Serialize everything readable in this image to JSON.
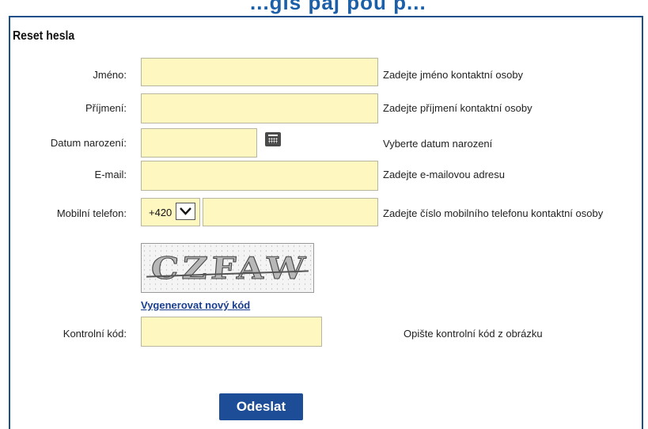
{
  "header": {
    "partial_title": "...gis paj  pou p..."
  },
  "panel": {
    "title": "Reset hesla"
  },
  "form": {
    "first_name": {
      "label": "Jméno:",
      "value": "",
      "hint": "Zadejte jméno kontaktní osoby"
    },
    "last_name": {
      "label": "Příjmení:",
      "value": "",
      "hint": "Zadejte příjmení kontaktní osoby"
    },
    "birth_date": {
      "label": "Datum narození:",
      "value": "",
      "hint": "Vyberte datum narození",
      "icon": "calendar-icon"
    },
    "email": {
      "label": "E-mail:",
      "value": "",
      "hint": "Zadejte e-mailovou adresu"
    },
    "mobile": {
      "label": "Mobilní telefon:",
      "prefix": "+420",
      "value": "",
      "hint": "Zadejte číslo mobilního telefonu kontaktní osoby"
    },
    "captcha": {
      "text": "CZFAW",
      "regenerate_label": "Vygenerovat nový kód"
    },
    "control_code": {
      "label": "Kontrolní kód:",
      "value": "",
      "hint": "Opište kontrolní kód z obrázku"
    }
  },
  "actions": {
    "submit_label": "Odeslat"
  },
  "colors": {
    "accent": "#1c4d96",
    "field_bg": "#fef7c0",
    "link": "#1a3f8f"
  }
}
